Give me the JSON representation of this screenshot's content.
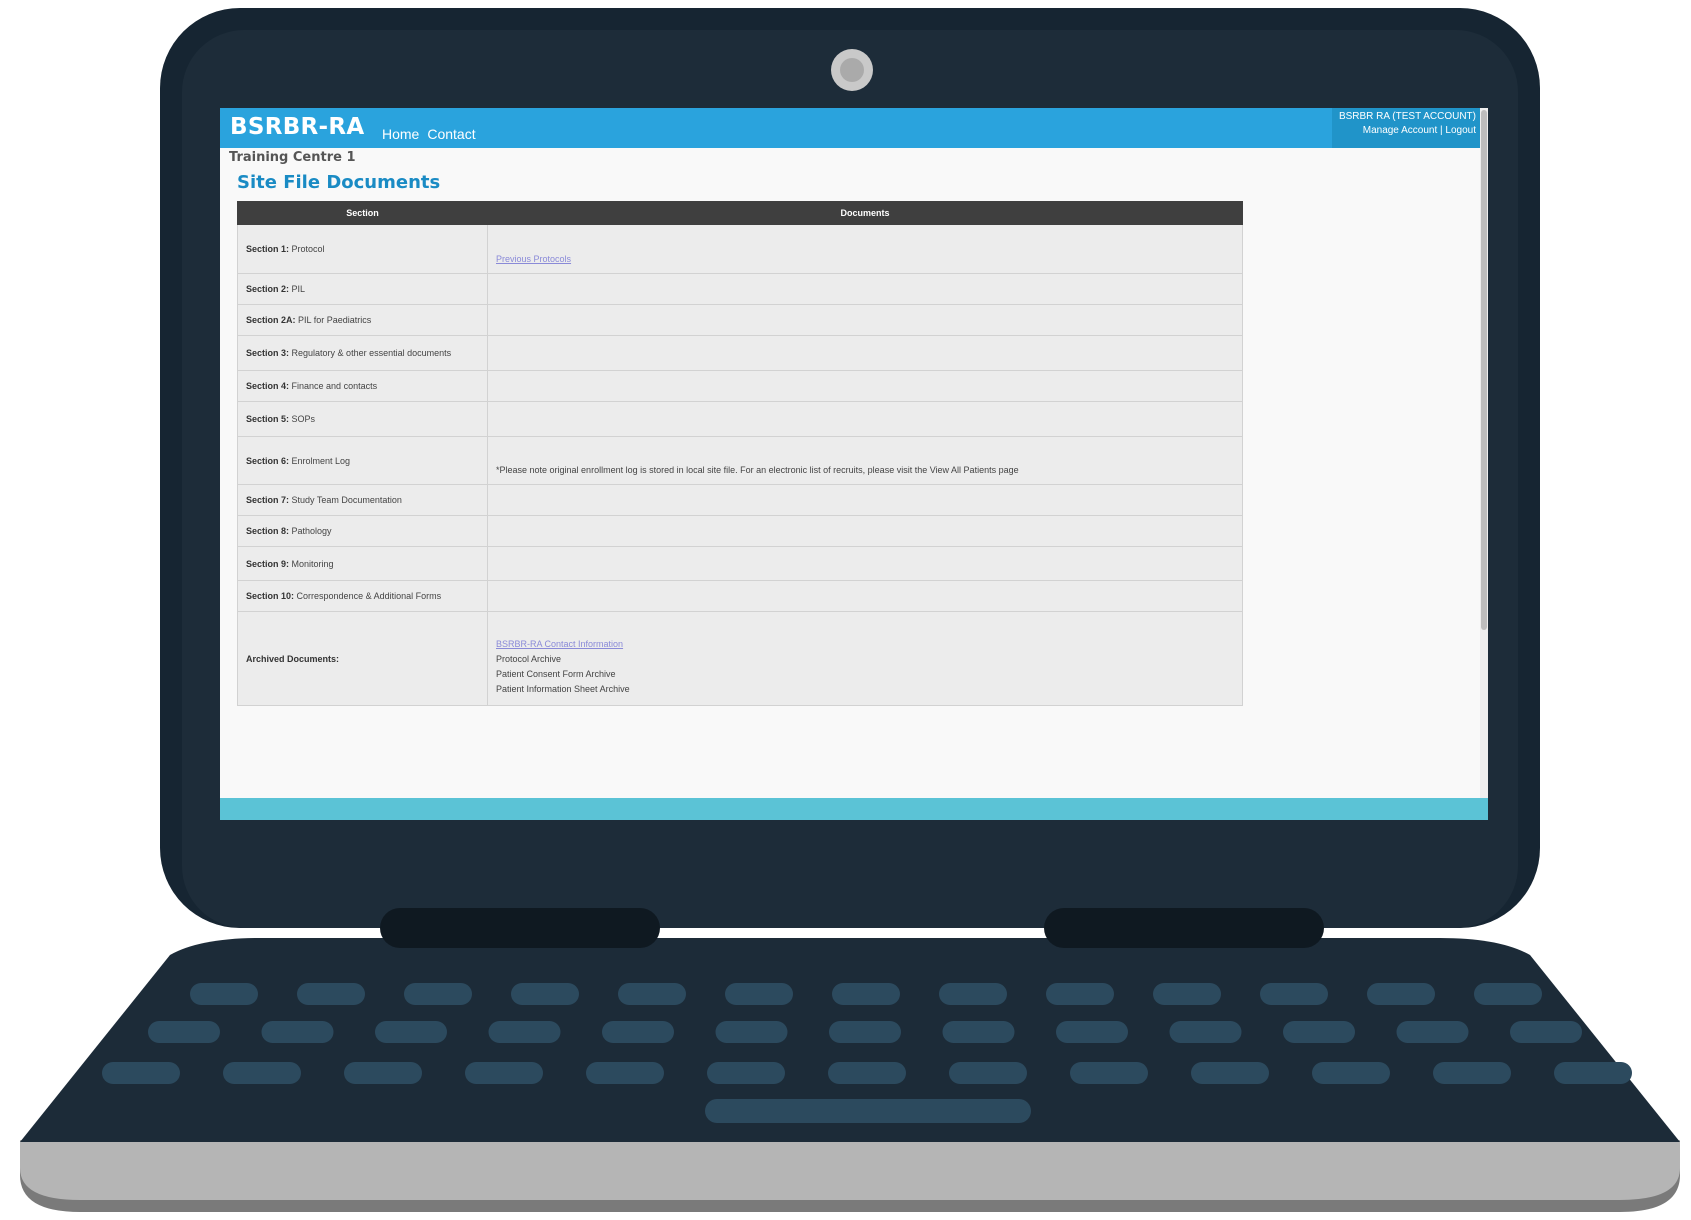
{
  "header": {
    "brand": "BSRBR-RA",
    "nav": [
      {
        "label": "Home"
      },
      {
        "label": "Contact"
      }
    ],
    "account": {
      "name": "BSRBR RA (TEST ACCOUNT)",
      "manage_label": "Manage Account",
      "separator": "|",
      "logout_label": "Logout"
    }
  },
  "centre_name": "Training Centre 1",
  "page_title": "Site File Documents",
  "table": {
    "headers": [
      "Section",
      "Documents"
    ],
    "rows": [
      {
        "label": "Section 1:",
        "name": "Protocol",
        "link": "Previous Protocols",
        "note": ""
      },
      {
        "label": "Section 2:",
        "name": "PIL",
        "link": "",
        "note": ""
      },
      {
        "label": "Section 2A:",
        "name": "PIL for Paediatrics",
        "link": "",
        "note": ""
      },
      {
        "label": "Section 3:",
        "name": "Regulatory & other essential documents",
        "link": "",
        "note": ""
      },
      {
        "label": "Section 4:",
        "name": "Finance and contacts",
        "link": "",
        "note": ""
      },
      {
        "label": "Section 5:",
        "name": "SOPs",
        "link": "",
        "note": ""
      },
      {
        "label": "Section 6:",
        "name": "Enrolment Log",
        "link": "",
        "note": "*Please note original enrollment log is stored in local site file. For an electronic list of recruits, please visit the View All Patients page"
      },
      {
        "label": "Section 7:",
        "name": "Study Team Documentation",
        "link": "",
        "note": ""
      },
      {
        "label": "Section 8:",
        "name": "Pathology",
        "link": "",
        "note": ""
      },
      {
        "label": "Section 9:",
        "name": "Monitoring",
        "link": "",
        "note": ""
      },
      {
        "label": "Section 10:",
        "name": "Correspondence & Additional Forms",
        "link": "",
        "note": ""
      }
    ],
    "archived": {
      "label": "Archived Documents:",
      "link": "BSRBR-RA Contact Information",
      "items": [
        "Protocol Archive",
        "Patient Consent Form Archive",
        "Patient Information Sheet Archive"
      ]
    }
  }
}
